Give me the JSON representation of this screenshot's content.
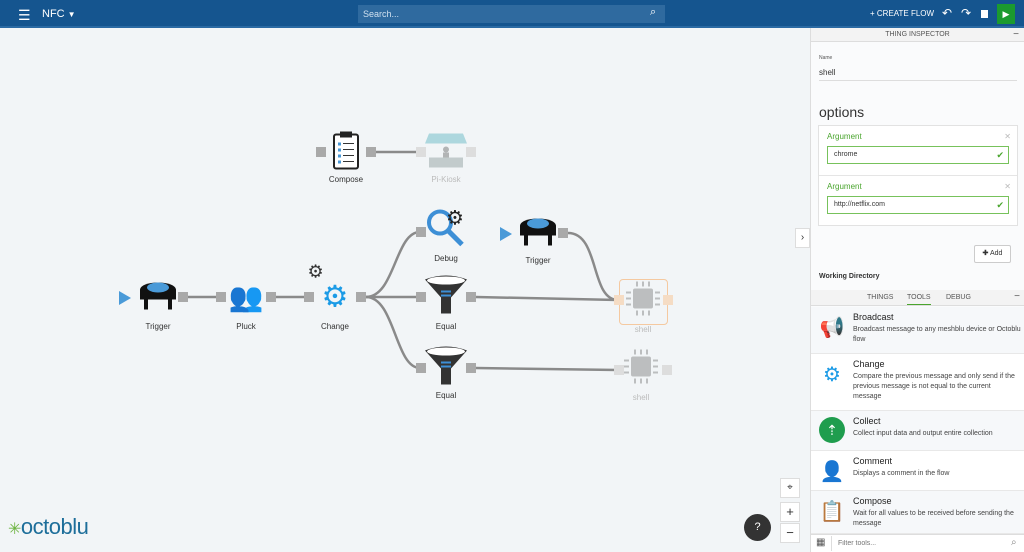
{
  "topbar": {
    "title": "NFC",
    "search_placeholder": "Search...",
    "create_flow": "+ CREATE FLOW",
    "colors": {
      "bar": "#15558f",
      "run": "#1b9a2f"
    }
  },
  "canvas": {
    "nodes": {
      "trigger1": "Trigger",
      "pluck": "Pluck",
      "change": "Change",
      "compose": "Compose",
      "pikiosk": "Pi-Kiosk",
      "debug": "Debug",
      "trigger2": "Trigger",
      "equal1": "Equal",
      "equal2": "Equal",
      "shell1": "shell",
      "shell2": "shell"
    },
    "logo": "octoblu"
  },
  "inspector": {
    "header": "THING INSPECTOR",
    "name_label": "Name",
    "name_value": "shell",
    "options_title": "options",
    "arguments": [
      {
        "label": "Argument",
        "value": "chrome"
      },
      {
        "label": "Argument",
        "value": "http://netflix.com"
      }
    ],
    "add_label": "Add",
    "working_dir_label": "Working Directory"
  },
  "tools_panel": {
    "tabs": [
      "THINGS",
      "TOOLS",
      "DEBUG"
    ],
    "active_tab": "TOOLS",
    "tools": [
      {
        "name": "Broadcast",
        "desc": "Broadcast message to any meshblu device or Octoblu flow",
        "icon": "megaphone-icon"
      },
      {
        "name": "Change",
        "desc": "Compare the previous message and only send if the previous message is not equal to the current message",
        "icon": "gears-icon"
      },
      {
        "name": "Collect",
        "desc": "Collect input data and output entire collection",
        "icon": "collect-icon"
      },
      {
        "name": "Comment",
        "desc": "Displays a comment in the flow",
        "icon": "comment-icon"
      },
      {
        "name": "Compose",
        "desc": "Wait for all values to be received before sending the message",
        "icon": "clipboard-icon"
      }
    ],
    "filter_placeholder": "Filter tools..."
  }
}
